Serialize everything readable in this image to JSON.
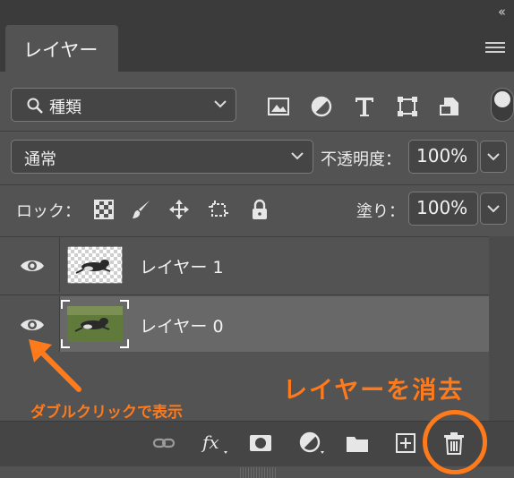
{
  "header": {
    "collapse_glyph": "‹‹",
    "tab_label": "レイヤー"
  },
  "filter": {
    "kind_label": "種類"
  },
  "blend": {
    "mode": "通常",
    "opacity_label": "不透明度：",
    "opacity_value": "100%"
  },
  "lock_row": {
    "lock_label": "ロック：",
    "fill_label": "塗り：",
    "fill_value": "100%"
  },
  "layers": [
    {
      "name": "レイヤー 1",
      "visible": true,
      "selected": false
    },
    {
      "name": "レイヤー 0",
      "visible": true,
      "selected": true
    }
  ],
  "annotations": {
    "double_click_hint": "ダブルクリックで表示",
    "delete_hint": "レイヤーを消去"
  },
  "colors": {
    "panel_bg": "#535353",
    "selected_row": "#686868",
    "accent_orange": "#ff7a1a"
  },
  "icons": [
    "search-icon",
    "image-filter-icon",
    "adjustment-filter-icon",
    "type-filter-icon",
    "shape-filter-icon",
    "smart-object-filter-icon",
    "lock-transparent-icon",
    "lock-image-icon",
    "lock-position-icon",
    "lock-artboard-icon",
    "lock-all-icon",
    "eye-icon",
    "link-icon",
    "fx-icon",
    "mask-icon",
    "adjustment-icon",
    "folder-icon",
    "new-layer-icon",
    "trash-icon"
  ]
}
